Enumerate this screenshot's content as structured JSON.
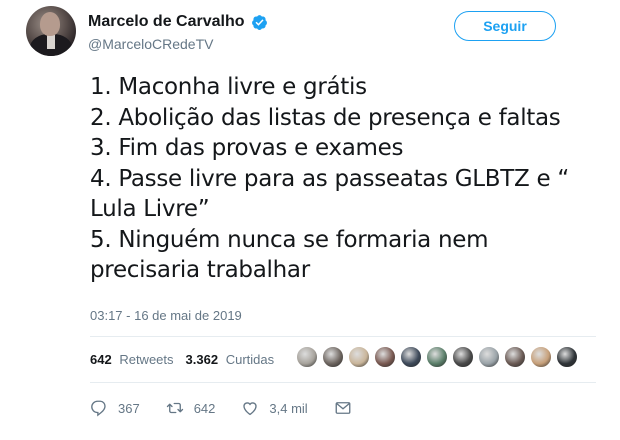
{
  "author": {
    "name": "Marcelo de Carvalho",
    "handle": "@MarceloCRedeTV",
    "verified_icon": "verified-badge-icon"
  },
  "follow_button": {
    "label": "Seguir"
  },
  "tweet": {
    "lines": [
      "1. Maconha livre e grátis",
      "2. Abolição das listas de presença e faltas",
      "3. Fim das provas e exames",
      "4. Passe livre para as passeatas GLBTZ e “",
      "Lula Livre”",
      "5. Ninguém nunca se formaria nem",
      "precisaria trabalhar"
    ],
    "timestamp": "03:17 - 16 de mai de 2019"
  },
  "stats": {
    "retweets_count": "642",
    "retweets_label": "Retweets",
    "likes_count": "3.362",
    "likes_label": "Curtidas",
    "liker_colors": [
      "#a7a39c",
      "#6e6660",
      "#c9b59a",
      "#7a5a52",
      "#3e4a5a",
      "#5b7f6a",
      "#4a4a4a",
      "#9aa3a8",
      "#6b5b55",
      "#c7a07a",
      "#2f3438"
    ]
  },
  "actions": {
    "reply": {
      "icon": "reply-icon",
      "count": "367"
    },
    "retweet": {
      "icon": "retweet-icon",
      "count": "642"
    },
    "like": {
      "icon": "heart-icon",
      "count": "3,4 mil"
    },
    "message": {
      "icon": "direct-message-icon"
    }
  },
  "colors": {
    "accent": "#1da1f2",
    "muted": "#657786",
    "text": "#14171a",
    "border": "#e6ecf0"
  }
}
